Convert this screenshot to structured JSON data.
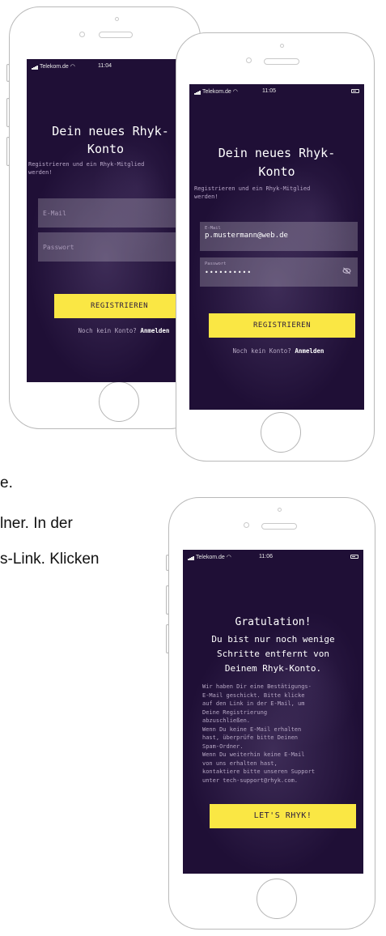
{
  "page_fragments": {
    "line1": "e.",
    "line2": "lner. In der",
    "line3": "s-Link. Klicken"
  },
  "phone_back": {
    "status": {
      "carrier": "Telekom.de",
      "time": "11:04"
    },
    "title_line1": "Dein neues Rhyk-",
    "title_line2": "Konto",
    "subtitle_line1": "Registrieren und ein Rhyk-Mitglied",
    "subtitle_line2": "werden!",
    "email_placeholder": "E-Mail",
    "password_placeholder": "Passwort",
    "register_button": "REGISTRIEREN",
    "no_account_text": "Noch kein Konto?",
    "login_link": "Anmelden"
  },
  "phone_front": {
    "status": {
      "carrier": "Telekom.de",
      "time": "11:05"
    },
    "title_line1": "Dein neues Rhyk-",
    "title_line2": "Konto",
    "subtitle_line1": "Registrieren und ein Rhyk-Mitglied",
    "subtitle_line2": "werden!",
    "email_label": "E-Mail",
    "email_value": "p.mustermann@web.de",
    "password_label": "Passwort",
    "password_value": "••••••••••",
    "register_button": "REGISTRIEREN",
    "no_account_text": "Noch kein Konto?",
    "login_link": "Anmelden"
  },
  "phone_bottom": {
    "status": {
      "carrier": "Telekom.de",
      "time": "11:06"
    },
    "title": "Gratulation!",
    "sub_line1": "Du bist nur noch wenige",
    "sub_line2": "Schritte entfernt von",
    "sub_line3": "Deinem Rhyk-Konto.",
    "body_lines": [
      "Wir haben Dir eine Bestätigungs-",
      "E-Mail geschickt. Bitte klicke",
      "auf den Link in der E-Mail, um",
      "Deine Registrierung",
      "abzuschließen.",
      "Wenn Du keine E-Mail erhalten",
      "hast, überprüfe bitte Deinen",
      "Spam-Ordner.",
      "Wenn Du weiterhin keine E-Mail",
      "von uns erhalten hast,",
      "kontaktiere bitte unseren Support",
      "unter tech-support@rhyk.com."
    ],
    "cta_button": "LET'S RHYK!"
  },
  "colors": {
    "screen_bg": "#1f0f36",
    "accent_yellow": "#fae744",
    "button_text": "#2a1b3c"
  }
}
